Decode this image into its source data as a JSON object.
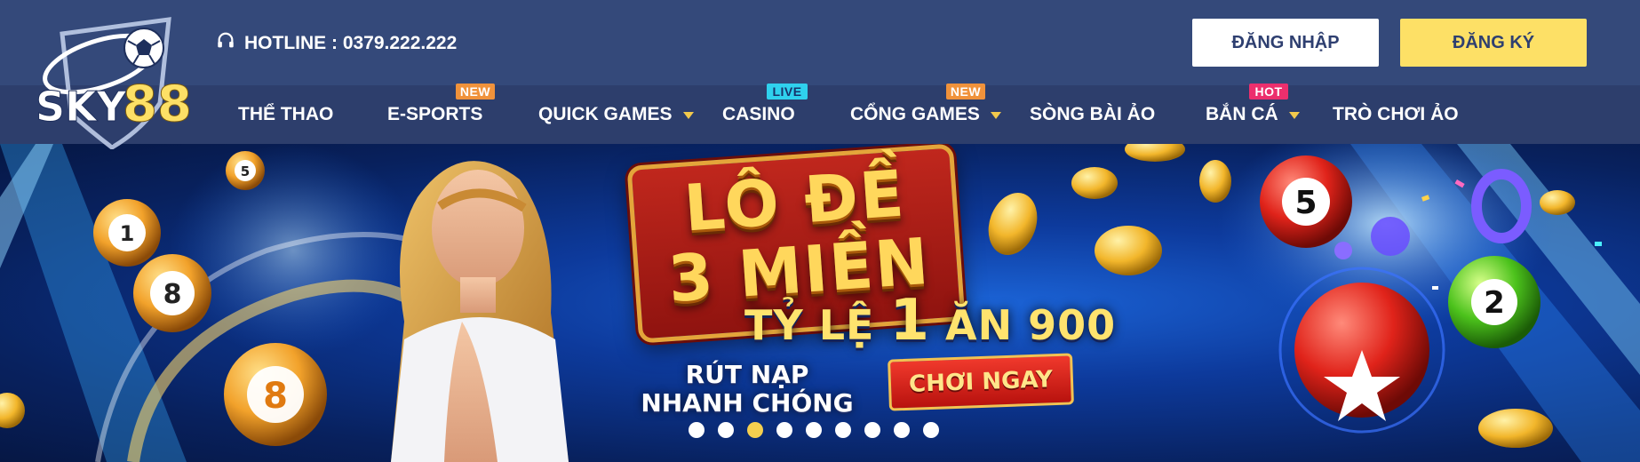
{
  "header": {
    "logo_text": "SKY88",
    "hotline": "HOTLINE : 0379.222.222",
    "login_label": "ĐĂNG NHẬP",
    "register_label": "ĐĂNG KÝ"
  },
  "nav": {
    "items": [
      {
        "label": "THỂ THAO"
      },
      {
        "label": "E-SPORTS",
        "badge": "NEW"
      },
      {
        "label": "QUICK GAMES",
        "dropdown": true
      },
      {
        "label": "CASINO",
        "badge": "LIVE"
      },
      {
        "label": "CỔNG GAMES",
        "badge": "NEW",
        "dropdown": true
      },
      {
        "label": "SÒNG BÀI ẢO"
      },
      {
        "label": "BẮN CÁ",
        "badge": "HOT",
        "dropdown": true
      },
      {
        "label": "TRÒ CHƠI ẢO"
      }
    ]
  },
  "banner": {
    "title_line1": "LÔ ĐỀ",
    "title_line2": "3 MIỀN",
    "odds_prefix": "TỶ LỆ ",
    "odds_big": "1",
    "odds_suffix": " ĂN 900",
    "subtitle_line1": "RÚT NẠP",
    "subtitle_line2": "NHANH CHÓNG",
    "cta_label": "CHƠI NGAY",
    "ball_numbers": [
      "5",
      "1",
      "8",
      "8",
      "5",
      "2"
    ],
    "slides_total": 9,
    "active_slide": 3
  },
  "colors": {
    "topbar": "#34497a",
    "navbar": "#2d3e6c",
    "accent_yellow": "#fde066",
    "badge_new": "#f0923b",
    "badge_live": "#2fd1ee",
    "badge_hot": "#ec2f6d"
  },
  "icons": {
    "hotline": "headset-icon",
    "dropdown": "caret-down-icon",
    "logo": "sky88-logo"
  }
}
